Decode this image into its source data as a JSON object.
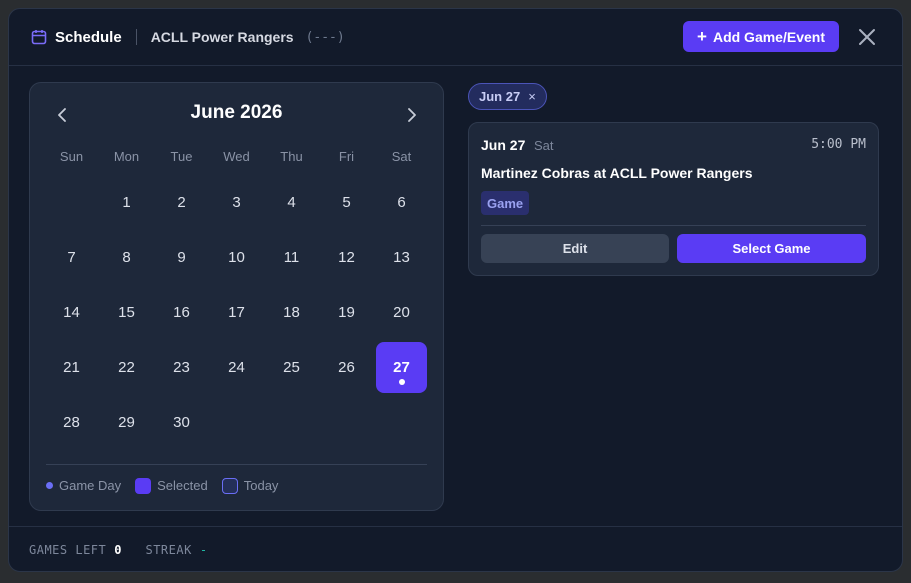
{
  "header": {
    "title": "Schedule",
    "team": "ACLL Power Rangers",
    "record": "(---)",
    "add_button": "Add Game/Event",
    "calendar_icon": "calendar-icon",
    "close_icon": "close-icon"
  },
  "calendar": {
    "month_label": "June 2026",
    "weekdays": [
      "Sun",
      "Mon",
      "Tue",
      "Wed",
      "Thu",
      "Fri",
      "Sat"
    ],
    "leading_blanks": 1,
    "days": [
      "1",
      "2",
      "3",
      "4",
      "5",
      "6",
      "7",
      "8",
      "9",
      "10",
      "11",
      "12",
      "13",
      "14",
      "15",
      "16",
      "17",
      "18",
      "19",
      "20",
      "21",
      "22",
      "23",
      "24",
      "25",
      "26",
      "27",
      "28",
      "29",
      "30"
    ],
    "selected_day": "27",
    "game_days": [
      "27"
    ],
    "legend": {
      "game_day": "Game Day",
      "selected": "Selected",
      "today": "Today"
    }
  },
  "filter_chip": {
    "label": "Jun 27",
    "remove": "×"
  },
  "event": {
    "date": "Jun 27",
    "weekday": "Sat",
    "time": "5:00 PM",
    "title": "Martinez Cobras at ACLL Power Rangers",
    "badge": "Game",
    "edit_label": "Edit",
    "select_label": "Select Game"
  },
  "footer": {
    "games_left_label": "GAMES LEFT",
    "games_left_value": "0",
    "streak_label": "STREAK",
    "streak_value": "-"
  },
  "colors": {
    "accent": "#5a3cf4",
    "background": "#121a2a",
    "panel": "#1e283a",
    "streak": "#1fb5a2"
  }
}
